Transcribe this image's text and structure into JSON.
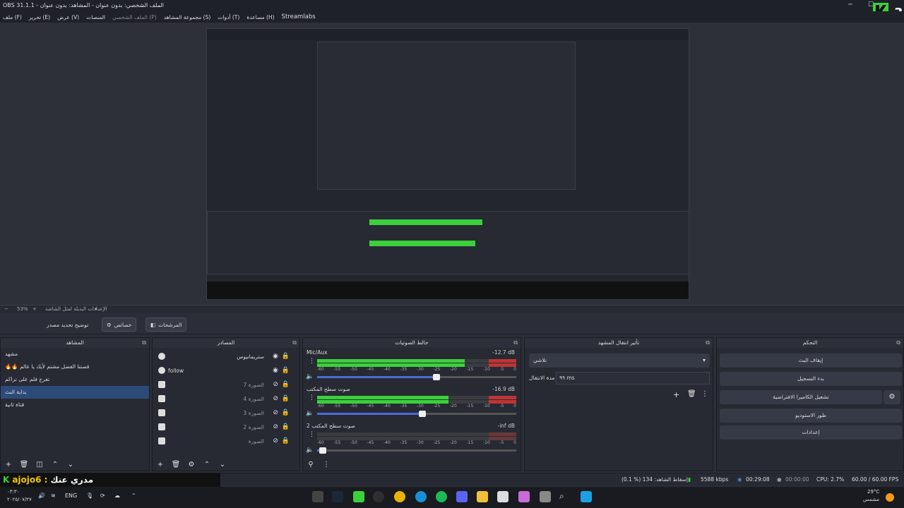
{
  "window": {
    "title": "OBS 31.1.1 - الملف الشخصي: بدون عنوان - المشاهد: بدون عنوان",
    "k_label": "3"
  },
  "menu": [
    "ملف (F)",
    "تحرير (E)",
    "عرض (V)",
    "المنصات",
    "الملف الشخصي (P)",
    "مجموعة المشاهد (S)",
    "أدوات (T)",
    "مساعدة (H)",
    "Streamlabs"
  ],
  "zoom": {
    "percent": "53%",
    "label": "الإعدادات البديلة لمثل الشاشة"
  },
  "strip": {
    "studio": "توضيح تحديد مصدر",
    "filters": "خصائص",
    "switch": "المرشحات"
  },
  "docks": {
    "scenes": "المشاهد",
    "sources": "المصادر",
    "mixer": "خالط الصوتيات",
    "transitions": "تأثير انتقال المشهد",
    "controls": "التحكم"
  },
  "scenes": [
    "مشهد",
    "🔥🔥 قصتنا الفضل مشتم لأيك يا عالم",
    "تفرج فلم على تراكم",
    "بداية البث",
    "قناة ثانية"
  ],
  "sources": [
    {
      "name": "ستريمانيوس",
      "dim": false,
      "visible": true
    },
    {
      "name": "follow",
      "dim": false,
      "visible": true
    },
    {
      "name": "الصورة 7",
      "dim": true,
      "visible": false
    },
    {
      "name": "الصورة 4",
      "dim": true,
      "visible": false
    },
    {
      "name": "الصورة 3",
      "dim": true,
      "visible": false
    },
    {
      "name": "الصورة 2",
      "dim": true,
      "visible": false
    },
    {
      "name": "الصورة",
      "dim": true,
      "visible": false
    }
  ],
  "mixer": [
    {
      "name": "Mic/Aux",
      "db": "-12.7 dB",
      "level": 0.74,
      "volume": 0.6
    },
    {
      "name": "صوت سطح المكتب",
      "db": "-16.9 dB",
      "level": 0.66,
      "volume": 0.53
    },
    {
      "name": "صوت سطح المكتب 2",
      "db": "-inf dB",
      "level": 0.0,
      "volume": 0.03
    }
  ],
  "ticks": [
    "-60",
    "-55",
    "-50",
    "-45",
    "-40",
    "-35",
    "-30",
    "-25",
    "-20",
    "-15",
    "-10",
    "-5",
    "0"
  ],
  "transition": {
    "selected": "تلاشي",
    "duration_label": "مدة الانتقال",
    "duration": "٩٩ ms"
  },
  "controls": [
    "إيقاف البث",
    "بدء التسجيل",
    "تشغيل الكاميرا الافتراضية",
    "طور الاستوديو",
    "إعدادات"
  ],
  "status": {
    "dropped": "(0.1 %) 134 :إسقاط الشاهد",
    "kbps": "5588 kbps",
    "live": "00:29:08",
    "rec": "00:00:00",
    "cpu": "CPU: 2.7%",
    "fps": "60.00 / 60.00 FPS"
  },
  "overlay": {
    "brand": "K",
    "user": "ajojo6 :",
    "text": "مدري عنك"
  },
  "taskbar": {
    "time": "٠٣:٣٠",
    "date": "٢٠٢٥/٠٧/٢٧",
    "lang": "ENG",
    "weather": "29°C",
    "weather_desc": "مشمس"
  },
  "colors": {
    "accent": "#2e4a78",
    "meter_green": "#3bd13b",
    "meter_yellow": "#c5c53a",
    "meter_red": "#c03434"
  }
}
